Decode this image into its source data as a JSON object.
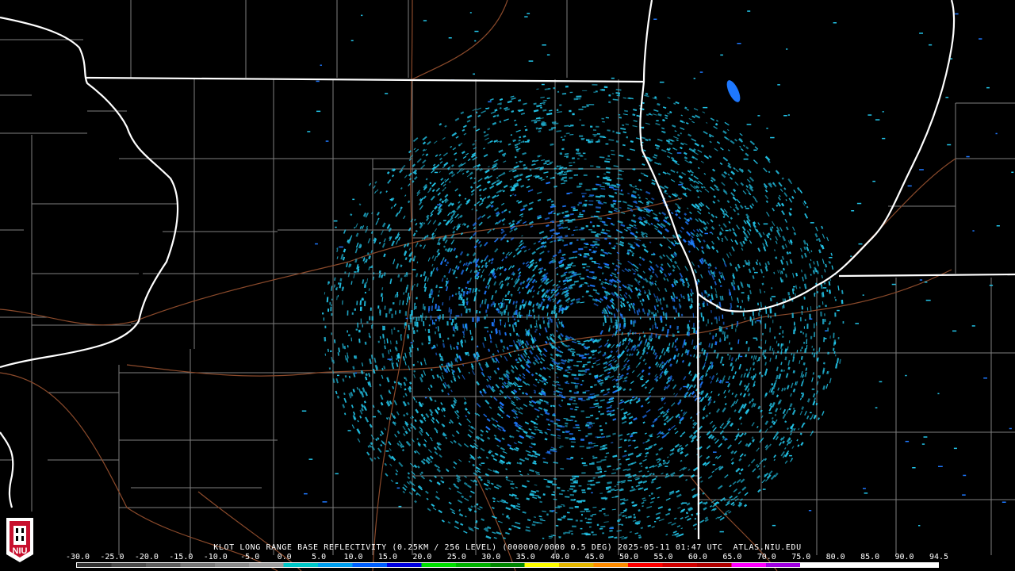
{
  "product": {
    "title": "KLOT LONG RANGE BASE REFLECTIVITY (0.25KM / 256 LEVEL) (000000/0000 0.5 DEG) 2025-05-11 01:47 UTC  ATLAS.NIU.EDU"
  },
  "scale": {
    "labels": [
      "-30.0",
      "-25.0",
      "-20.0",
      "-15.0",
      "-10.0",
      "-5.0",
      "0.0",
      "5.0",
      "10.0",
      "15.0",
      "20.0",
      "25.0",
      "30.0",
      "35.0",
      "40.0",
      "45.0",
      "50.0",
      "55.0",
      "60.0",
      "65.0",
      "70.0",
      "75.0",
      "80.0",
      "85.0",
      "90.0",
      "94.5"
    ],
    "colors": [
      "#333333",
      "#4a4a4a",
      "#5e5e5e",
      "#777777",
      "#8a8a8a",
      "#9e9e9e",
      "#00c8c8",
      "#00a0f0",
      "#0060ff",
      "#0000e0",
      "#00e000",
      "#00b400",
      "#008800",
      "#ffff00",
      "#e6b800",
      "#ff8c00",
      "#ff0000",
      "#d00000",
      "#b00000",
      "#ff00ff",
      "#a000e0",
      "#ffffff",
      "#ffffff",
      "#ffffff",
      "#ffffff"
    ]
  },
  "logo": {
    "text": "NIU"
  },
  "colors": {
    "background": "#000000",
    "state_border": "#ffffff",
    "county_border": "#7f7f7f",
    "highway": "#8b4a2b",
    "echo_light": "#22c4e8",
    "echo_mid": "#1e78ff"
  }
}
